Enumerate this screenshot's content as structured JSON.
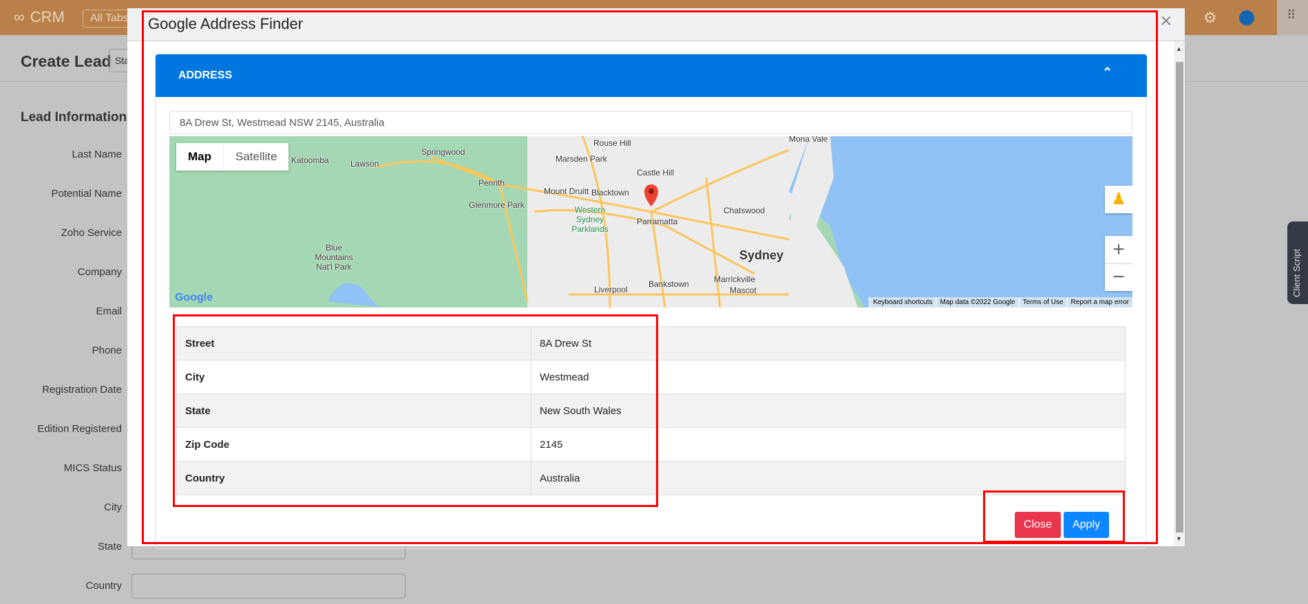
{
  "topbar": {
    "app_name": "CRM",
    "all_tabs": "All Tabs"
  },
  "page": {
    "title": "Create Lead",
    "standard_btn": "Sta",
    "section": "Lead Information",
    "fields": [
      "Last Name",
      "Potential Name",
      "Zoho Service",
      "Company",
      "Email",
      "Phone",
      "Registration Date",
      "Edition Registered",
      "MICS Status",
      "City",
      "State",
      "Country"
    ]
  },
  "client_script": "Client Script",
  "modal": {
    "title": "Google Address Finder",
    "card_title": "ADDRESS",
    "address_value": "8A Drew St, Westmead NSW 2145, Australia",
    "map": {
      "map_tab": "Map",
      "satellite_tab": "Satellite",
      "logo": "Google",
      "labels": [
        "Katoomba",
        "Lawson",
        "Springwood",
        "Rouse Hill",
        "Marsden Park",
        "Penrith",
        "Castle Hill",
        "Mount Druitt",
        "Blacktown",
        "Glenmore Park",
        "Chatswood",
        "Western Sydney Parklands",
        "Parramatta",
        "Blue Mountains Nat'l Park",
        "Sydney",
        "Marrickville",
        "Bankstown",
        "Liverpool",
        "Mascot",
        "Mona Vale"
      ],
      "attribution": [
        "Keyboard shortcuts",
        "Map data ©2022 Google",
        "Terms of Use",
        "Report a map error"
      ],
      "colors": {
        "land": "#a4d8b4",
        "urban": "#ececec",
        "water": "#90c2f5",
        "road": "#fbc55a"
      }
    },
    "rows": [
      {
        "label": "Street",
        "value": "8A Drew St"
      },
      {
        "label": "City",
        "value": "Westmead"
      },
      {
        "label": "State",
        "value": "New South Wales"
      },
      {
        "label": "Zip Code",
        "value": "2145"
      },
      {
        "label": "Country",
        "value": "Australia"
      }
    ],
    "close_label": "Close",
    "apply_label": "Apply"
  },
  "colors": {
    "accent": "#0077e0",
    "close": "#e8364e",
    "apply": "#0d86ff",
    "highlight": "#ff0000"
  }
}
